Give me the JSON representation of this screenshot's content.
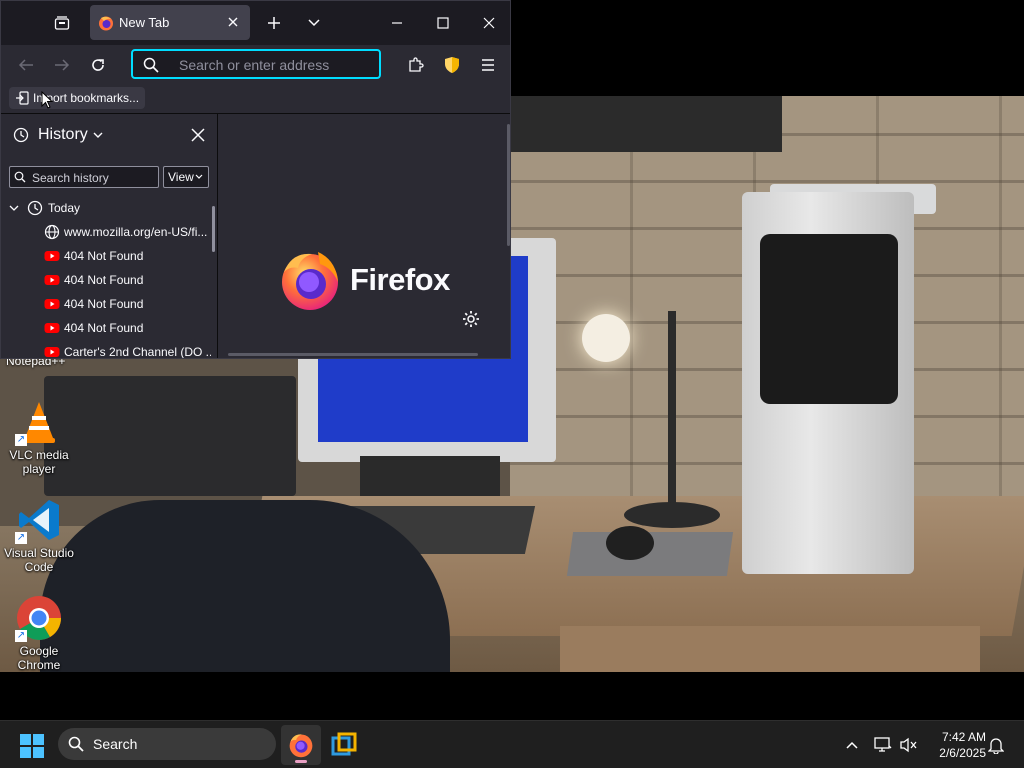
{
  "browser": {
    "tab": {
      "title": "New Tab"
    },
    "urlbar": {
      "placeholder": "Search or enter address"
    },
    "bookmarks_toolbar": {
      "import_label": "Import bookmarks..."
    },
    "sidebar": {
      "title": "History",
      "search_placeholder": "Search history",
      "view_label": "View",
      "group": "Today",
      "entries": [
        {
          "label": "www.mozilla.org/en-US/fi...",
          "icon": "globe-icon"
        },
        {
          "label": "404 Not Found",
          "icon": "youtube-icon"
        },
        {
          "label": "404 Not Found",
          "icon": "youtube-icon"
        },
        {
          "label": "404 Not Found",
          "icon": "youtube-icon"
        },
        {
          "label": "404 Not Found",
          "icon": "youtube-icon"
        },
        {
          "label": "Carter's 2nd Channel (DO ...",
          "icon": "youtube-icon"
        }
      ]
    },
    "newtab": {
      "brand": "Firefox"
    }
  },
  "desktop": {
    "partial_label": "Notepad++",
    "icons": [
      {
        "label": "VLC media player"
      },
      {
        "label": "Visual Studio Code"
      },
      {
        "label": "Google Chrome"
      }
    ]
  },
  "taskbar": {
    "search_label": "Search",
    "time": "7:42 AM",
    "date": "2/6/2025"
  },
  "colors": {
    "accent_focus": "#00ddff",
    "browser_bg": "#1c1b22",
    "toolbar_bg": "#2b2a33",
    "taskbar_bg": "#1f1f1f",
    "youtube_red": "#ff0000"
  }
}
